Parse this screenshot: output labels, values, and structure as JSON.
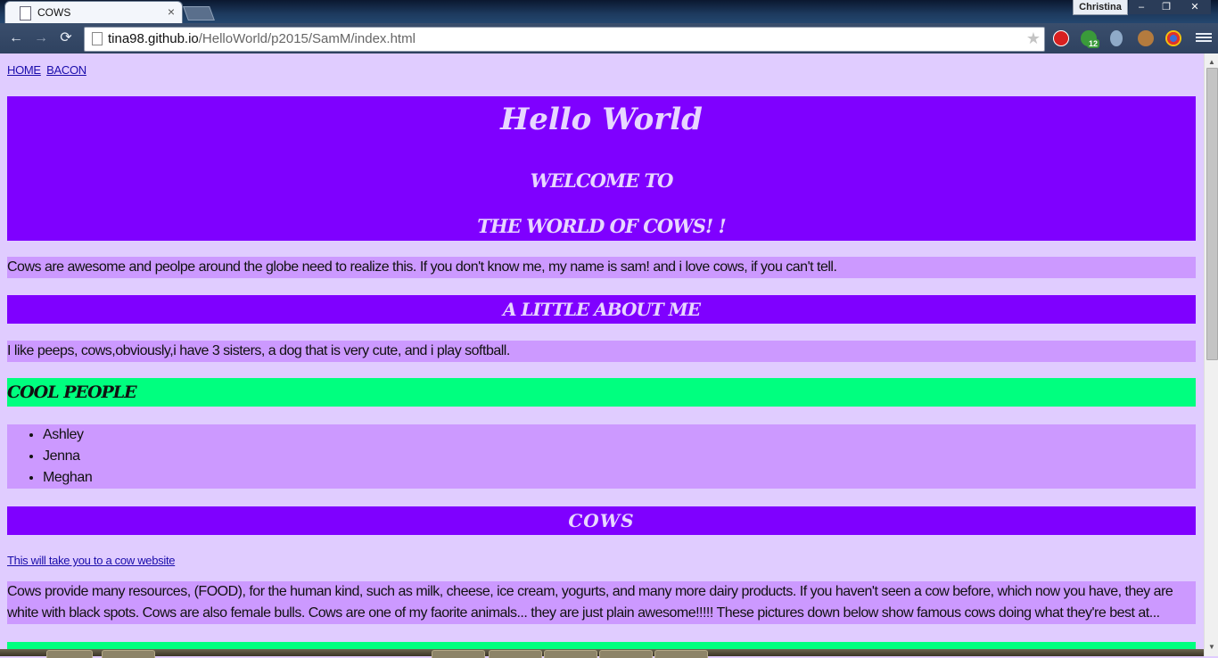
{
  "browser": {
    "tab": {
      "title": "COWS"
    },
    "profile_name": "Christina",
    "window": {
      "minimize": "–",
      "maximize": "❐",
      "close": "✕"
    },
    "nav": {
      "back": "←",
      "forward": "→",
      "reload": "⟳"
    },
    "address": {
      "host": "tina98.github.io",
      "path": "/HelloWorld/p2015/SamM/index.html"
    },
    "extensions": [
      "adblock-icon",
      "evernote-icon",
      "ghostery-icon",
      "cookie-icon",
      "chrome-icon"
    ],
    "extension_badge": "12"
  },
  "page": {
    "nav_links": [
      "HOME",
      "BACON"
    ],
    "hero": {
      "title": "Hello World",
      "subtitle1": "WELCOME TO",
      "subtitle2": "THE WORLD OF COWS! !"
    },
    "intro": "Cows are awesome and peolpe around the globe need to realize this. If you don't know me, my name is sam! and i love cows, if you can't tell.",
    "about_heading": "A LITTLE ABOUT ME",
    "about_text": "I like peeps, cows,obviously,i have 3 sisters, a dog that is very cute, and i play softball.",
    "cool_heading": "COOL PEOPLE",
    "cool_people": [
      "Ashley",
      "Jenna",
      "Meghan"
    ],
    "cows_heading": "COWS",
    "cow_link": "This will take you to a cow website",
    "cows_text": "Cows provide many resources, (FOOD), for the human kind, such as milk, cheese, ice cream, yogurts, and many more dairy products. If you haven't seen a cow before, which now you have, they are white with black spots. Cows are also female bulls. Cows are one of my faorite animals... they are just plain awesome!!!!! These pictures down below show famous cows doing what they're best at... TAKING SELFIES!... and PHOTOBOMBING!"
  },
  "colors": {
    "page_bg": "#e0ccff",
    "purple": "#7f00ff",
    "lavender": "#cc99ff",
    "green": "#00ff7f",
    "heading_text": "#e8d6ff"
  }
}
